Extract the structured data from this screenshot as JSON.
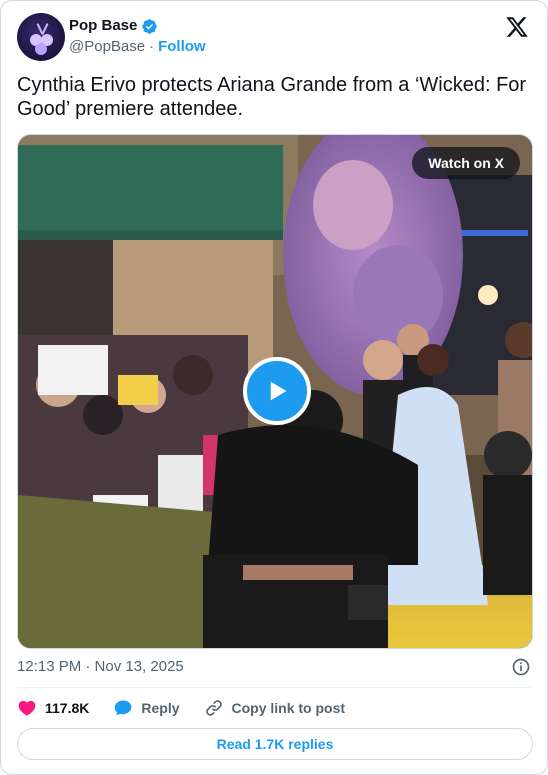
{
  "author": {
    "display_name": "Pop Base",
    "handle": "@PopBase",
    "separator": "·",
    "follow_label": "Follow",
    "verified": true
  },
  "tweet": {
    "text": "Cynthia Erivo protects Ariana Grande from a ‘Wicked: For Good’ premiere attendee."
  },
  "media": {
    "watch_label": "Watch on X",
    "play_icon": "play-icon"
  },
  "meta": {
    "timestamp": "12:13 PM · Nov 13, 2025"
  },
  "actions": {
    "likes": "117.8K",
    "reply_label": "Reply",
    "copy_label": "Copy link to post"
  },
  "read_replies_label": "Read 1.7K replies",
  "colors": {
    "accent": "#1d9bf0",
    "like": "#f91880",
    "text": "#0f1419",
    "muted": "#536471",
    "border": "#cfd9de"
  }
}
